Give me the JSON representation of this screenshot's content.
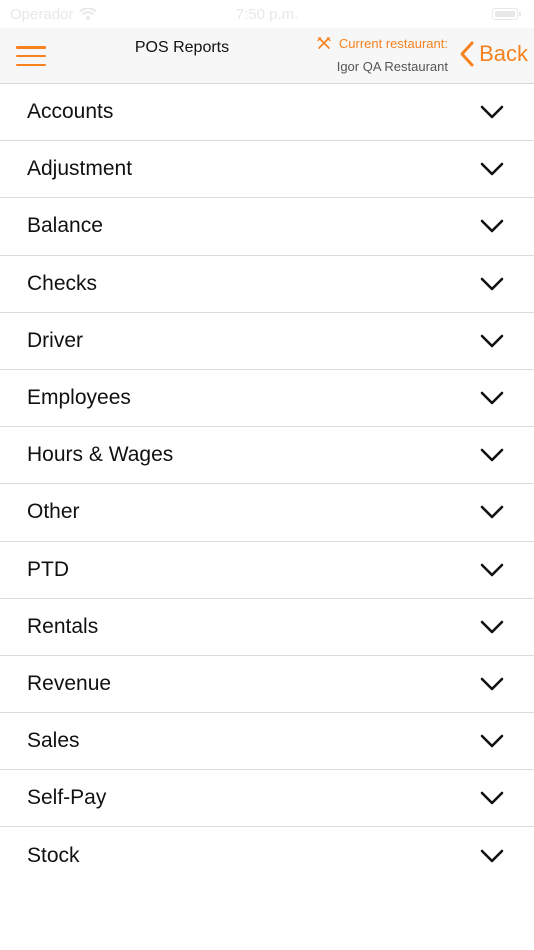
{
  "status_bar": {
    "carrier": "Operador",
    "time": "7:50 p.m."
  },
  "nav": {
    "title": "POS Reports",
    "restaurant_label": "Current restaurant:",
    "restaurant_name": "Igor QA Restaurant",
    "back_label": "Back",
    "accent_color": "#f5821f"
  },
  "reports": [
    {
      "label": "Accounts"
    },
    {
      "label": "Adjustment"
    },
    {
      "label": "Balance"
    },
    {
      "label": "Checks"
    },
    {
      "label": "Driver"
    },
    {
      "label": "Employees"
    },
    {
      "label": "Hours & Wages"
    },
    {
      "label": "Other"
    },
    {
      "label": "PTD"
    },
    {
      "label": "Rentals"
    },
    {
      "label": "Revenue"
    },
    {
      "label": "Sales"
    },
    {
      "label": "Self-Pay"
    },
    {
      "label": "Stock"
    }
  ]
}
